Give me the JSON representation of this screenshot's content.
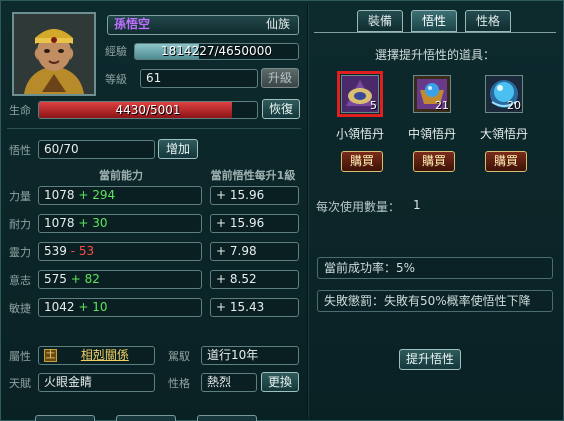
{
  "character": {
    "name": "孫悟空",
    "race": "仙族",
    "exp_label": "經驗",
    "exp_value": "1814227/4650000",
    "exp_fraction": 0.39,
    "level_label": "等級",
    "level_value": "61",
    "level_up_button": "升級",
    "hp_label": "生命",
    "hp_value": "4430/5001",
    "hp_fraction": 0.886,
    "restore_button": "恢復"
  },
  "comprehension": {
    "label": "悟性",
    "value": "60/70",
    "increase_button": "增加"
  },
  "stats": {
    "header_current": "當前能力",
    "header_per_level": "當前悟性每升1級",
    "rows": [
      {
        "label": "力量",
        "base": "1078",
        "bonus": "+ 294",
        "bonus_color": "green",
        "per_level": "+ 15.96"
      },
      {
        "label": "耐力",
        "base": "1078",
        "bonus": "+ 30",
        "bonus_color": "green",
        "per_level": "+ 15.96"
      },
      {
        "label": "靈力",
        "base": "539",
        "bonus": "- 53",
        "bonus_color": "red",
        "per_level": "+ 7.98"
      },
      {
        "label": "意志",
        "base": "575",
        "bonus": "+ 82",
        "bonus_color": "green",
        "per_level": "+ 8.52"
      },
      {
        "label": "敏捷",
        "base": "1042",
        "bonus": "+ 10",
        "bonus_color": "green",
        "per_level": "+ 15.43"
      }
    ]
  },
  "attributes": {
    "element_label": "屬性",
    "element_value": "土",
    "relation_link": "相剋關係",
    "control_label": "駕馭",
    "control_value": "道行10年",
    "talent_label": "天賦",
    "talent_value": "火眼金睛",
    "personality_label": "性格",
    "personality_value": "熱烈",
    "change_button": "更換"
  },
  "tabs": [
    {
      "label": "裝備",
      "active": false
    },
    {
      "label": "悟性",
      "active": true
    },
    {
      "label": "性格",
      "active": false
    }
  ],
  "items_panel": {
    "title": "選擇提升悟性的道具：",
    "items": [
      {
        "name": "小領悟丹",
        "count": "5",
        "selected": true,
        "color": "#b59a3a",
        "buy_label": "購買"
      },
      {
        "name": "中領悟丹",
        "count": "21",
        "selected": false,
        "color": "#3a8ecf",
        "buy_label": "購買"
      },
      {
        "name": "大領悟丹",
        "count": "20",
        "selected": false,
        "color": "#3fb0e8",
        "buy_label": "購買"
      }
    ],
    "use_count_label": "每次使用數量：",
    "use_count_value": "1",
    "success_rate_label": "當前成功率：",
    "success_rate_value": "5%",
    "failure_penalty": "失敗懲罰：失敗有50%概率使悟性下降",
    "upgrade_button": "提升悟性"
  },
  "colors": {
    "background": "#0b2427",
    "border": "#5e7f80",
    "hp_bar": "#c0282c",
    "exp_bar": "#6fa9b0",
    "name_color": "#c070ff",
    "selected_item_border": "#e02020",
    "link_color": "#f0d060"
  }
}
